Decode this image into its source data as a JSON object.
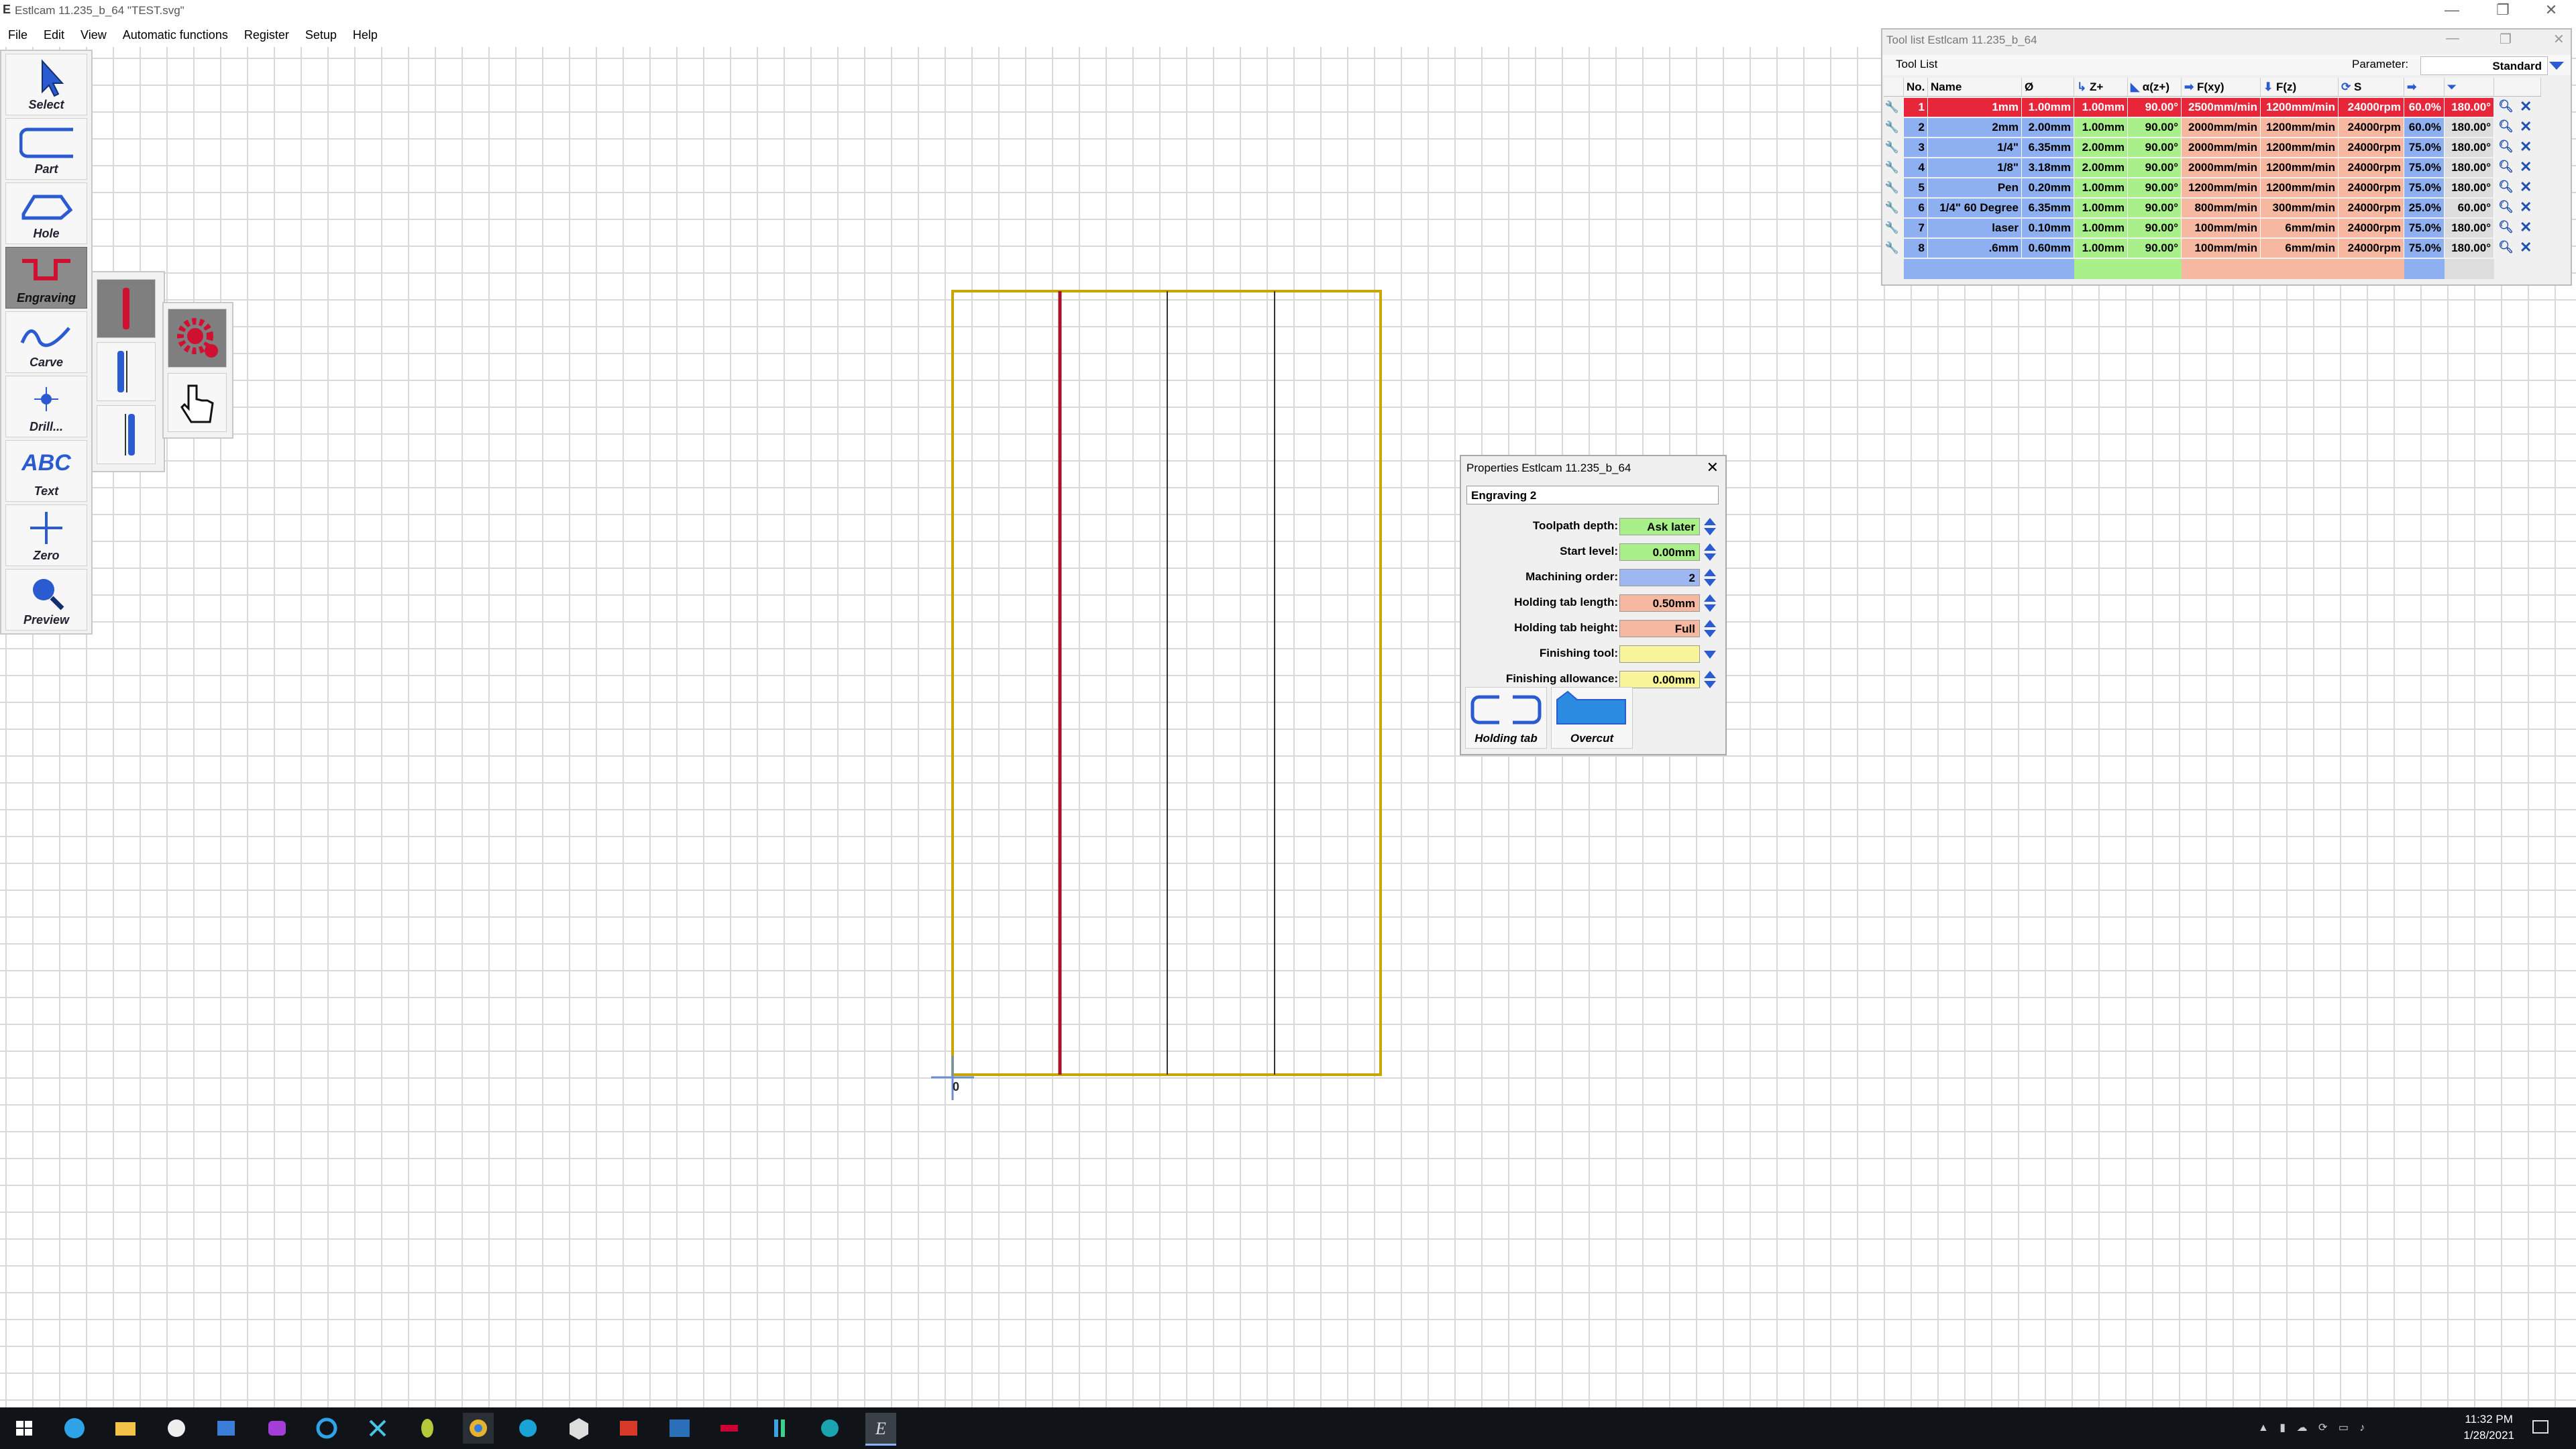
{
  "window": {
    "title": "Estlcam 11.235_b_64 \"TEST.svg\"",
    "controls": [
      "—",
      "❐",
      "✕"
    ]
  },
  "menu": [
    "File",
    "Edit",
    "View",
    "Automatic functions",
    "Register",
    "Setup",
    "Help"
  ],
  "left_toolbar": [
    {
      "label": "Select",
      "icon": "arrow-cursor-icon"
    },
    {
      "label": "Part",
      "icon": "part-outline-icon"
    },
    {
      "label": "Hole",
      "icon": "hole-outline-icon"
    },
    {
      "label": "Engraving",
      "icon": "engraving-icon",
      "active": true
    },
    {
      "label": "Carve",
      "icon": "carve-wave-icon"
    },
    {
      "label": "Drill...",
      "icon": "drill-point-icon"
    },
    {
      "label": "Text",
      "icon": "text-abc-icon"
    },
    {
      "label": "Zero",
      "icon": "zero-cross-icon"
    },
    {
      "label": "Preview",
      "icon": "magnifier-icon"
    }
  ],
  "drawing": {
    "origin_label": "0"
  },
  "tool_list": {
    "window_title": "Tool list Estlcam 11.235_b_64",
    "tab": "Tool List",
    "parameter_label": "Parameter:",
    "parameter_value": "Standard",
    "columns": [
      "No.",
      "Name",
      "Ø",
      "Z+",
      "α(z+)",
      "F(xy)",
      "F(z)",
      "S",
      "",
      ""
    ],
    "rows": [
      {
        "no": "1",
        "name": "1mm",
        "dia": "1.00mm",
        "z": "1.00mm",
        "angle": "90.00°",
        "fxy": "2500mm/min",
        "fz": "1200mm/min",
        "s": "24000rpm",
        "pct": "60.0%",
        "deg": "180.00°",
        "selected": true
      },
      {
        "no": "2",
        "name": "2mm",
        "dia": "2.00mm",
        "z": "1.00mm",
        "angle": "90.00°",
        "fxy": "2000mm/min",
        "fz": "1200mm/min",
        "s": "24000rpm",
        "pct": "60.0%",
        "deg": "180.00°"
      },
      {
        "no": "3",
        "name": "1/4\"",
        "dia": "6.35mm",
        "z": "2.00mm",
        "angle": "90.00°",
        "fxy": "2000mm/min",
        "fz": "1200mm/min",
        "s": "24000rpm",
        "pct": "75.0%",
        "deg": "180.00°"
      },
      {
        "no": "4",
        "name": "1/8\"",
        "dia": "3.18mm",
        "z": "2.00mm",
        "angle": "90.00°",
        "fxy": "2000mm/min",
        "fz": "1200mm/min",
        "s": "24000rpm",
        "pct": "75.0%",
        "deg": "180.00°"
      },
      {
        "no": "5",
        "name": "Pen",
        "dia": "0.20mm",
        "z": "1.00mm",
        "angle": "90.00°",
        "fxy": "1200mm/min",
        "fz": "1200mm/min",
        "s": "24000rpm",
        "pct": "75.0%",
        "deg": "180.00°"
      },
      {
        "no": "6",
        "name": "1/4\" 60 Degree",
        "dia": "6.35mm",
        "z": "1.00mm",
        "angle": "90.00°",
        "fxy": "800mm/min",
        "fz": "300mm/min",
        "s": "24000rpm",
        "pct": "25.0%",
        "deg": "60.00°"
      },
      {
        "no": "7",
        "name": "laser",
        "dia": "0.10mm",
        "z": "1.00mm",
        "angle": "90.00°",
        "fxy": "100mm/min",
        "fz": "6mm/min",
        "s": "24000rpm",
        "pct": "75.0%",
        "deg": "180.00°"
      },
      {
        "no": "8",
        "name": ".6mm",
        "dia": "0.60mm",
        "z": "1.00mm",
        "angle": "90.00°",
        "fxy": "100mm/min",
        "fz": "6mm/min",
        "s": "24000rpm",
        "pct": "75.0%",
        "deg": "180.00°"
      }
    ]
  },
  "properties": {
    "window_title": "Properties Estlcam 11.235_b_64",
    "name": "Engraving 2",
    "fields": [
      {
        "label": "Toolpath depth:",
        "value": "Ask later",
        "color": "#a9f08a"
      },
      {
        "label": "Start level:",
        "value": "0.00mm",
        "color": "#a9f08a"
      },
      {
        "label": "Machining order:",
        "value": "2",
        "color": "#9fb7f0"
      },
      {
        "label": "Holding tab length:",
        "value": "0.50mm",
        "color": "#f7b8a2"
      },
      {
        "label": "Holding tab height:",
        "value": "Full",
        "color": "#f7b8a2"
      },
      {
        "label": "Finishing tool:",
        "value": "",
        "color": "#f8f59a"
      },
      {
        "label": "Finishing allowance:",
        "value": "0.00mm",
        "color": "#f8f59a"
      }
    ],
    "buttons": [
      {
        "label": "Holding tab",
        "icon": "holding-tab-icon"
      },
      {
        "label": "Overcut",
        "icon": "overcut-icon"
      }
    ]
  },
  "taskbar": {
    "time": "11:32 PM",
    "date": "1/28/2021"
  },
  "colors": {
    "selected_row": "#e8263a",
    "row_blue": "#8fb0f0",
    "col_green": "#a9f08a",
    "col_salmon": "#f7b8a2",
    "part_outline": "#c7a600",
    "engraving_selected": "#a8112a"
  }
}
